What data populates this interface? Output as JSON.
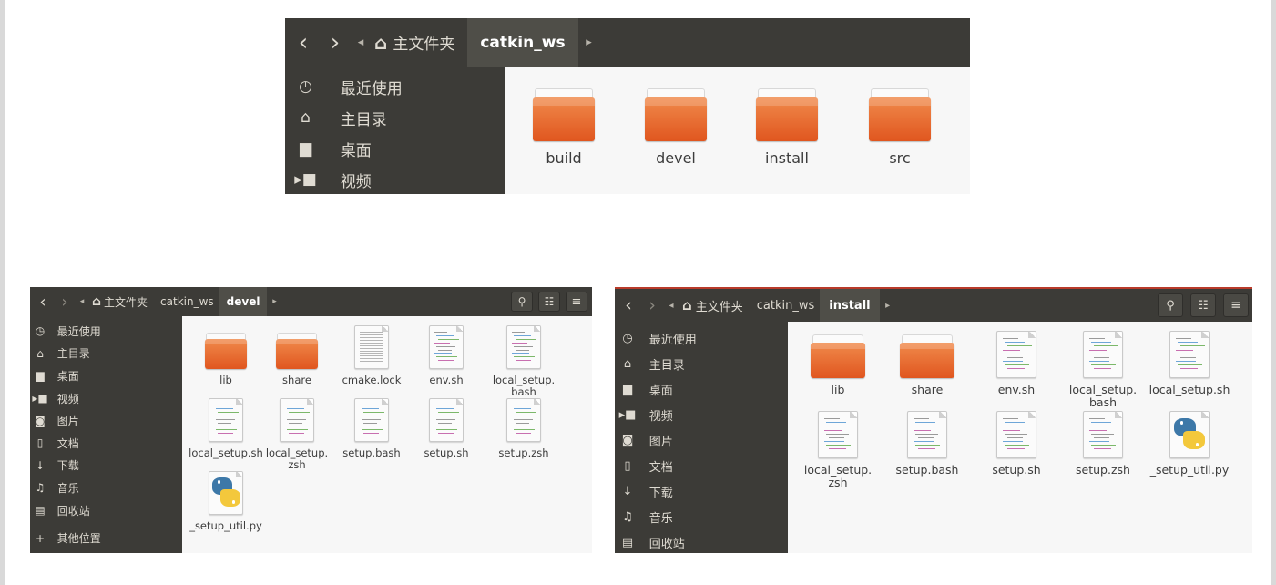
{
  "top_window": {
    "breadcrumb": {
      "home_label": "主文件夹",
      "current": "catkin_ws"
    },
    "sidebar": [
      {
        "icon": "clock-icon",
        "label": "最近使用"
      },
      {
        "icon": "home-icon",
        "label": "主目录"
      },
      {
        "icon": "folder-icon",
        "label": "桌面"
      },
      {
        "icon": "video-icon",
        "label": "视频"
      }
    ],
    "files": [
      {
        "name": "build",
        "type": "folder"
      },
      {
        "name": "devel",
        "type": "folder"
      },
      {
        "name": "install",
        "type": "folder"
      },
      {
        "name": "src",
        "type": "folder"
      }
    ]
  },
  "devel_window": {
    "breadcrumb": {
      "home_label": "主文件夹",
      "parent": "catkin_ws",
      "current": "devel"
    },
    "sidebar": [
      {
        "icon": "clock-icon",
        "label": "最近使用"
      },
      {
        "icon": "home-icon",
        "label": "主目录"
      },
      {
        "icon": "folder-icon",
        "label": "桌面"
      },
      {
        "icon": "video-icon",
        "label": "视频"
      },
      {
        "icon": "camera-icon",
        "label": "图片"
      },
      {
        "icon": "document-icon",
        "label": "文档"
      },
      {
        "icon": "download-icon",
        "label": "下载"
      },
      {
        "icon": "music-icon",
        "label": "音乐"
      },
      {
        "icon": "trash-icon",
        "label": "回收站"
      },
      {
        "icon": "plus-icon",
        "label": "其他位置"
      }
    ],
    "files": [
      {
        "name": "lib",
        "type": "folder"
      },
      {
        "name": "share",
        "type": "folder"
      },
      {
        "name": "cmake.lock",
        "type": "text"
      },
      {
        "name": "env.sh",
        "type": "script"
      },
      {
        "name": "local_setup.\nbash",
        "type": "script"
      },
      {
        "name": "local_setup.sh",
        "type": "script"
      },
      {
        "name": "local_setup.\nzsh",
        "type": "script"
      },
      {
        "name": "setup.bash",
        "type": "script"
      },
      {
        "name": "setup.sh",
        "type": "script"
      },
      {
        "name": "setup.zsh",
        "type": "script"
      },
      {
        "name": "_setup_util.py",
        "type": "python"
      }
    ]
  },
  "install_window": {
    "breadcrumb": {
      "home_label": "主文件夹",
      "parent": "catkin_ws",
      "current": "install"
    },
    "sidebar": [
      {
        "icon": "clock-icon",
        "label": "最近使用"
      },
      {
        "icon": "home-icon",
        "label": "主目录"
      },
      {
        "icon": "folder-icon",
        "label": "桌面"
      },
      {
        "icon": "video-icon",
        "label": "视频"
      },
      {
        "icon": "camera-icon",
        "label": "图片"
      },
      {
        "icon": "document-icon",
        "label": "文档"
      },
      {
        "icon": "download-icon",
        "label": "下载"
      },
      {
        "icon": "music-icon",
        "label": "音乐"
      },
      {
        "icon": "trash-icon",
        "label": "回收站"
      }
    ],
    "files": [
      {
        "name": "lib",
        "type": "folder"
      },
      {
        "name": "share",
        "type": "folder"
      },
      {
        "name": "env.sh",
        "type": "script"
      },
      {
        "name": "local_setup.\nbash",
        "type": "script"
      },
      {
        "name": "local_setup.sh",
        "type": "script"
      },
      {
        "name": "local_setup.\nzsh",
        "type": "script"
      },
      {
        "name": "setup.bash",
        "type": "script"
      },
      {
        "name": "setup.sh",
        "type": "script"
      },
      {
        "name": "setup.zsh",
        "type": "script"
      },
      {
        "name": "_setup_util.py",
        "type": "python"
      }
    ]
  },
  "icons": {
    "back": "‹",
    "forward": "›",
    "left_arrow": "◂",
    "right_arrow": "▸",
    "home": "⌂",
    "search": "⚲",
    "view_toggle": "☷",
    "menu": "≡"
  },
  "colors": {
    "titlebar": "#3c3b37",
    "sidebar": "#3c3b37",
    "content": "#f7f7f7",
    "folder_top": "#f08a4b",
    "folder_bottom": "#e0561f"
  }
}
